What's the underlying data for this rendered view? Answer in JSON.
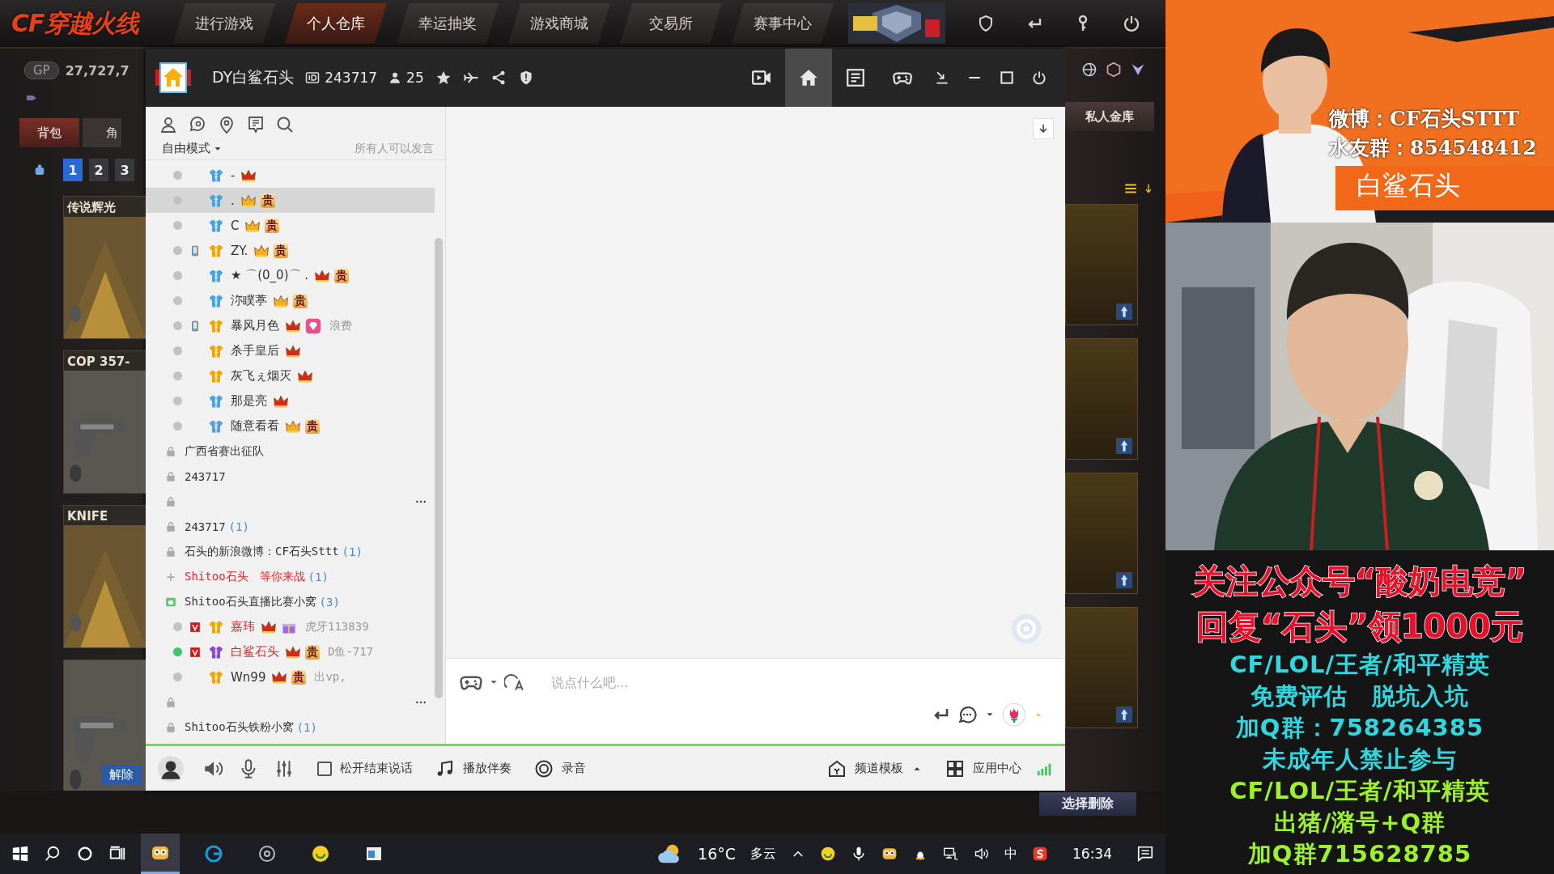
{
  "game": {
    "logo": "CF穿越火线",
    "tabs": [
      {
        "label": "进行游戏",
        "selected": false
      },
      {
        "label": "个人仓库",
        "selected": true
      },
      {
        "label": "幸运抽奖",
        "selected": false
      },
      {
        "label": "游戏商城",
        "selected": false
      },
      {
        "label": "交易所",
        "selected": false
      },
      {
        "label": "赛事中心",
        "selected": false
      }
    ],
    "gp": {
      "label": "GP",
      "value": "27,727,7"
    },
    "bag_tabs": [
      {
        "label": "背包",
        "selected": true
      },
      {
        "label": "角",
        "selected": false
      }
    ],
    "pages": [
      {
        "label": "1",
        "selected": true
      },
      {
        "label": "2",
        "selected": false
      },
      {
        "label": "3",
        "selected": false
      }
    ],
    "cards": [
      {
        "title": "传说辉光"
      },
      {
        "title": "COP 357-"
      },
      {
        "title": "KNIFE"
      },
      {
        "button": "解除"
      }
    ],
    "vault_button": "私人金库",
    "delete_button": "选择删除"
  },
  "channel_window": {
    "name": "DY白鲨石头",
    "id": "243717",
    "online": "25",
    "nav": [
      {
        "kind": "video",
        "selected": false
      },
      {
        "kind": "home",
        "selected": true
      },
      {
        "kind": "list",
        "selected": false
      },
      {
        "kind": "gamepad",
        "selected": false
      }
    ],
    "mode": "自由模式",
    "speak_rule": "所有人可以发言",
    "tree": [
      {
        "kind": "user",
        "name": "-",
        "color": "#4aa3e0",
        "badges": [
          {
            "kind": "crown",
            "color": "#d42a1e"
          }
        ],
        "selected": false,
        "speaking": false,
        "mobile": false,
        "vip": false,
        "highlight": false
      },
      {
        "kind": "user",
        "name": ".",
        "color": "#4aa3e0",
        "badges": [
          {
            "kind": "crown",
            "color": "#f0b020"
          },
          {
            "kind": "noble",
            "label": "贵"
          }
        ],
        "selected": true,
        "speaking": false,
        "mobile": false,
        "vip": false,
        "highlight": false
      },
      {
        "kind": "user",
        "name": "C",
        "color": "#4aa3e0",
        "badges": [
          {
            "kind": "crown",
            "color": "#f0b020"
          },
          {
            "kind": "noble",
            "label": "贵"
          }
        ],
        "selected": false,
        "speaking": false,
        "mobile": false,
        "vip": false,
        "highlight": false
      },
      {
        "kind": "user",
        "name": "ZY.",
        "color": "#f0a800",
        "badges": [
          {
            "kind": "crown",
            "color": "#f0b020"
          },
          {
            "kind": "noble",
            "label": "贵"
          }
        ],
        "selected": false,
        "speaking": false,
        "mobile": true,
        "vip": false,
        "highlight": false
      },
      {
        "kind": "user",
        "name": "★ ⌒(0_0)⌒ .",
        "color": "#4aa3e0",
        "badges": [
          {
            "kind": "crown",
            "color": "#d42a1e"
          },
          {
            "kind": "noble",
            "label": "贵"
          }
        ],
        "selected": false,
        "speaking": false,
        "mobile": false,
        "vip": false,
        "highlight": false
      },
      {
        "kind": "user",
        "name": "沵瞨葶",
        "color": "#4aa3e0",
        "badges": [
          {
            "kind": "crown",
            "color": "#f0b020"
          },
          {
            "kind": "noble",
            "label": "贵"
          }
        ],
        "selected": false,
        "speaking": false,
        "mobile": false,
        "vip": false,
        "highlight": false
      },
      {
        "kind": "user",
        "name": "暴风月色",
        "color": "#f0a800",
        "badges": [
          {
            "kind": "crown",
            "color": "#d42a1e"
          },
          {
            "kind": "gem",
            "color": "#e8508a"
          }
        ],
        "note": "浪费",
        "selected": false,
        "speaking": false,
        "mobile": true,
        "vip": false,
        "highlight": false
      },
      {
        "kind": "user",
        "name": "杀手皇后",
        "color": "#f0a800",
        "badges": [
          {
            "kind": "crown",
            "color": "#d42a1e"
          }
        ],
        "selected": false,
        "speaking": false,
        "mobile": false,
        "vip": false,
        "highlight": false
      },
      {
        "kind": "user",
        "name": "灰飞ぇ烟灭",
        "color": "#f0a800",
        "badges": [
          {
            "kind": "crown",
            "color": "#d42a1e"
          }
        ],
        "selected": false,
        "speaking": false,
        "mobile": false,
        "vip": false,
        "highlight": false
      },
      {
        "kind": "user",
        "name": "那是亮",
        "color": "#4aa3e0",
        "badges": [
          {
            "kind": "crown",
            "color": "#d42a1e"
          }
        ],
        "selected": false,
        "speaking": false,
        "mobile": false,
        "vip": false,
        "highlight": false
      },
      {
        "kind": "user",
        "name": "随意看看",
        "color": "#5aa0d0",
        "badges": [
          {
            "kind": "crown",
            "color": "#f0b020"
          },
          {
            "kind": "noble",
            "label": "贵"
          }
        ],
        "selected": false,
        "speaking": false,
        "mobile": false,
        "vip": false,
        "highlight": false
      },
      {
        "kind": "locked-channel",
        "name": "广西省赛出征队",
        "more": false,
        "highlight": false
      },
      {
        "kind": "locked-channel",
        "name": "243717",
        "more": false,
        "highlight": false
      },
      {
        "kind": "locked-channel",
        "more": true
      },
      {
        "kind": "locked-channel",
        "name": "243717",
        "count": "(1)",
        "more": false,
        "highlight": false
      },
      {
        "kind": "locked-channel",
        "name": "石头的新浪微博：CF石头Sttt",
        "count": "(1)",
        "more": false,
        "highlight": false
      },
      {
        "kind": "closed-channel",
        "name": "Shitoo石头　等你来战",
        "count": "(1)",
        "more": false,
        "highlight": true
      },
      {
        "kind": "open-channel",
        "name": "Shitoo石头直播比赛小窝",
        "count": "(3)",
        "more": false,
        "highlight": false,
        "children": [
          {
            "kind": "user",
            "name": "嘉玮",
            "color": "#f0a800",
            "badges": [
              {
                "kind": "crown",
                "color": "#d42a1e"
              },
              {
                "kind": "gift",
                "color": "#9a6ae0"
              }
            ],
            "note": "虎牙113839",
            "selected": false,
            "speaking": false,
            "mobile": false,
            "vip": true,
            "highlight": true
          },
          {
            "kind": "user",
            "name": "白鲨石头",
            "color": "#8a4ad0",
            "badges": [
              {
                "kind": "crown",
                "color": "#d42a1e"
              },
              {
                "kind": "noble",
                "label": "贵"
              }
            ],
            "note": "D鱼-717",
            "selected": false,
            "speaking": true,
            "mobile": false,
            "vip": true,
            "highlight": true
          },
          {
            "kind": "user",
            "name": "Wn99",
            "color": "#f0a800",
            "badges": [
              {
                "kind": "crown",
                "color": "#d42a1e"
              },
              {
                "kind": "noble",
                "label": "贵"
              }
            ],
            "note": "出vp,",
            "selected": false,
            "speaking": false,
            "mobile": false,
            "vip": false,
            "highlight": false
          }
        ]
      },
      {
        "kind": "locked-channel",
        "more": true
      },
      {
        "kind": "locked-channel",
        "name": "Shitoo石头铁粉小窝",
        "count": "(1)",
        "more": false,
        "highlight": false
      }
    ],
    "input": {
      "placeholder": "说点什么吧..."
    },
    "bottom": {
      "hold_to_talk": {
        "label": "松开结束说话",
        "checked": false
      },
      "music": "播放伴奏",
      "record": "录音",
      "template": "频道模板",
      "apps": "应用中心"
    }
  },
  "stream": {
    "banner": {
      "weibo": "微博：CF石头STTT",
      "group": "水友群：854548412",
      "name": "白鲨石头"
    },
    "promo": [
      {
        "text": "关注公众号“酸奶电竞”",
        "color": "#e8102a",
        "kind": "headline"
      },
      {
        "text": "回复“石头”领1000元",
        "color": "#e8102a",
        "kind": "headline"
      },
      {
        "text": "CF/LOL/王者/和平精英",
        "color": "#2fd8e0",
        "kind": "line"
      },
      {
        "text": "免费评估　脱坑入坑",
        "color": "#2fd8e0",
        "kind": "line"
      },
      {
        "text": "加Q群：758264385",
        "color": "#2fd8e0",
        "kind": "line"
      },
      {
        "text": "未成年人禁止参与",
        "color": "#2fd8e0",
        "kind": "line"
      },
      {
        "text": "CF/LOL/王者/和平精英",
        "color": "#9ef02a",
        "kind": "line"
      },
      {
        "text": "出猪/潴号+Q群",
        "color": "#9ef02a",
        "kind": "line"
      },
      {
        "text": "加Q群715628785",
        "color": "#9ef02a",
        "kind": "line"
      }
    ]
  },
  "taskbar": {
    "temperature": "16°C",
    "weather": "多云",
    "ime": "中",
    "time": "16:34"
  }
}
